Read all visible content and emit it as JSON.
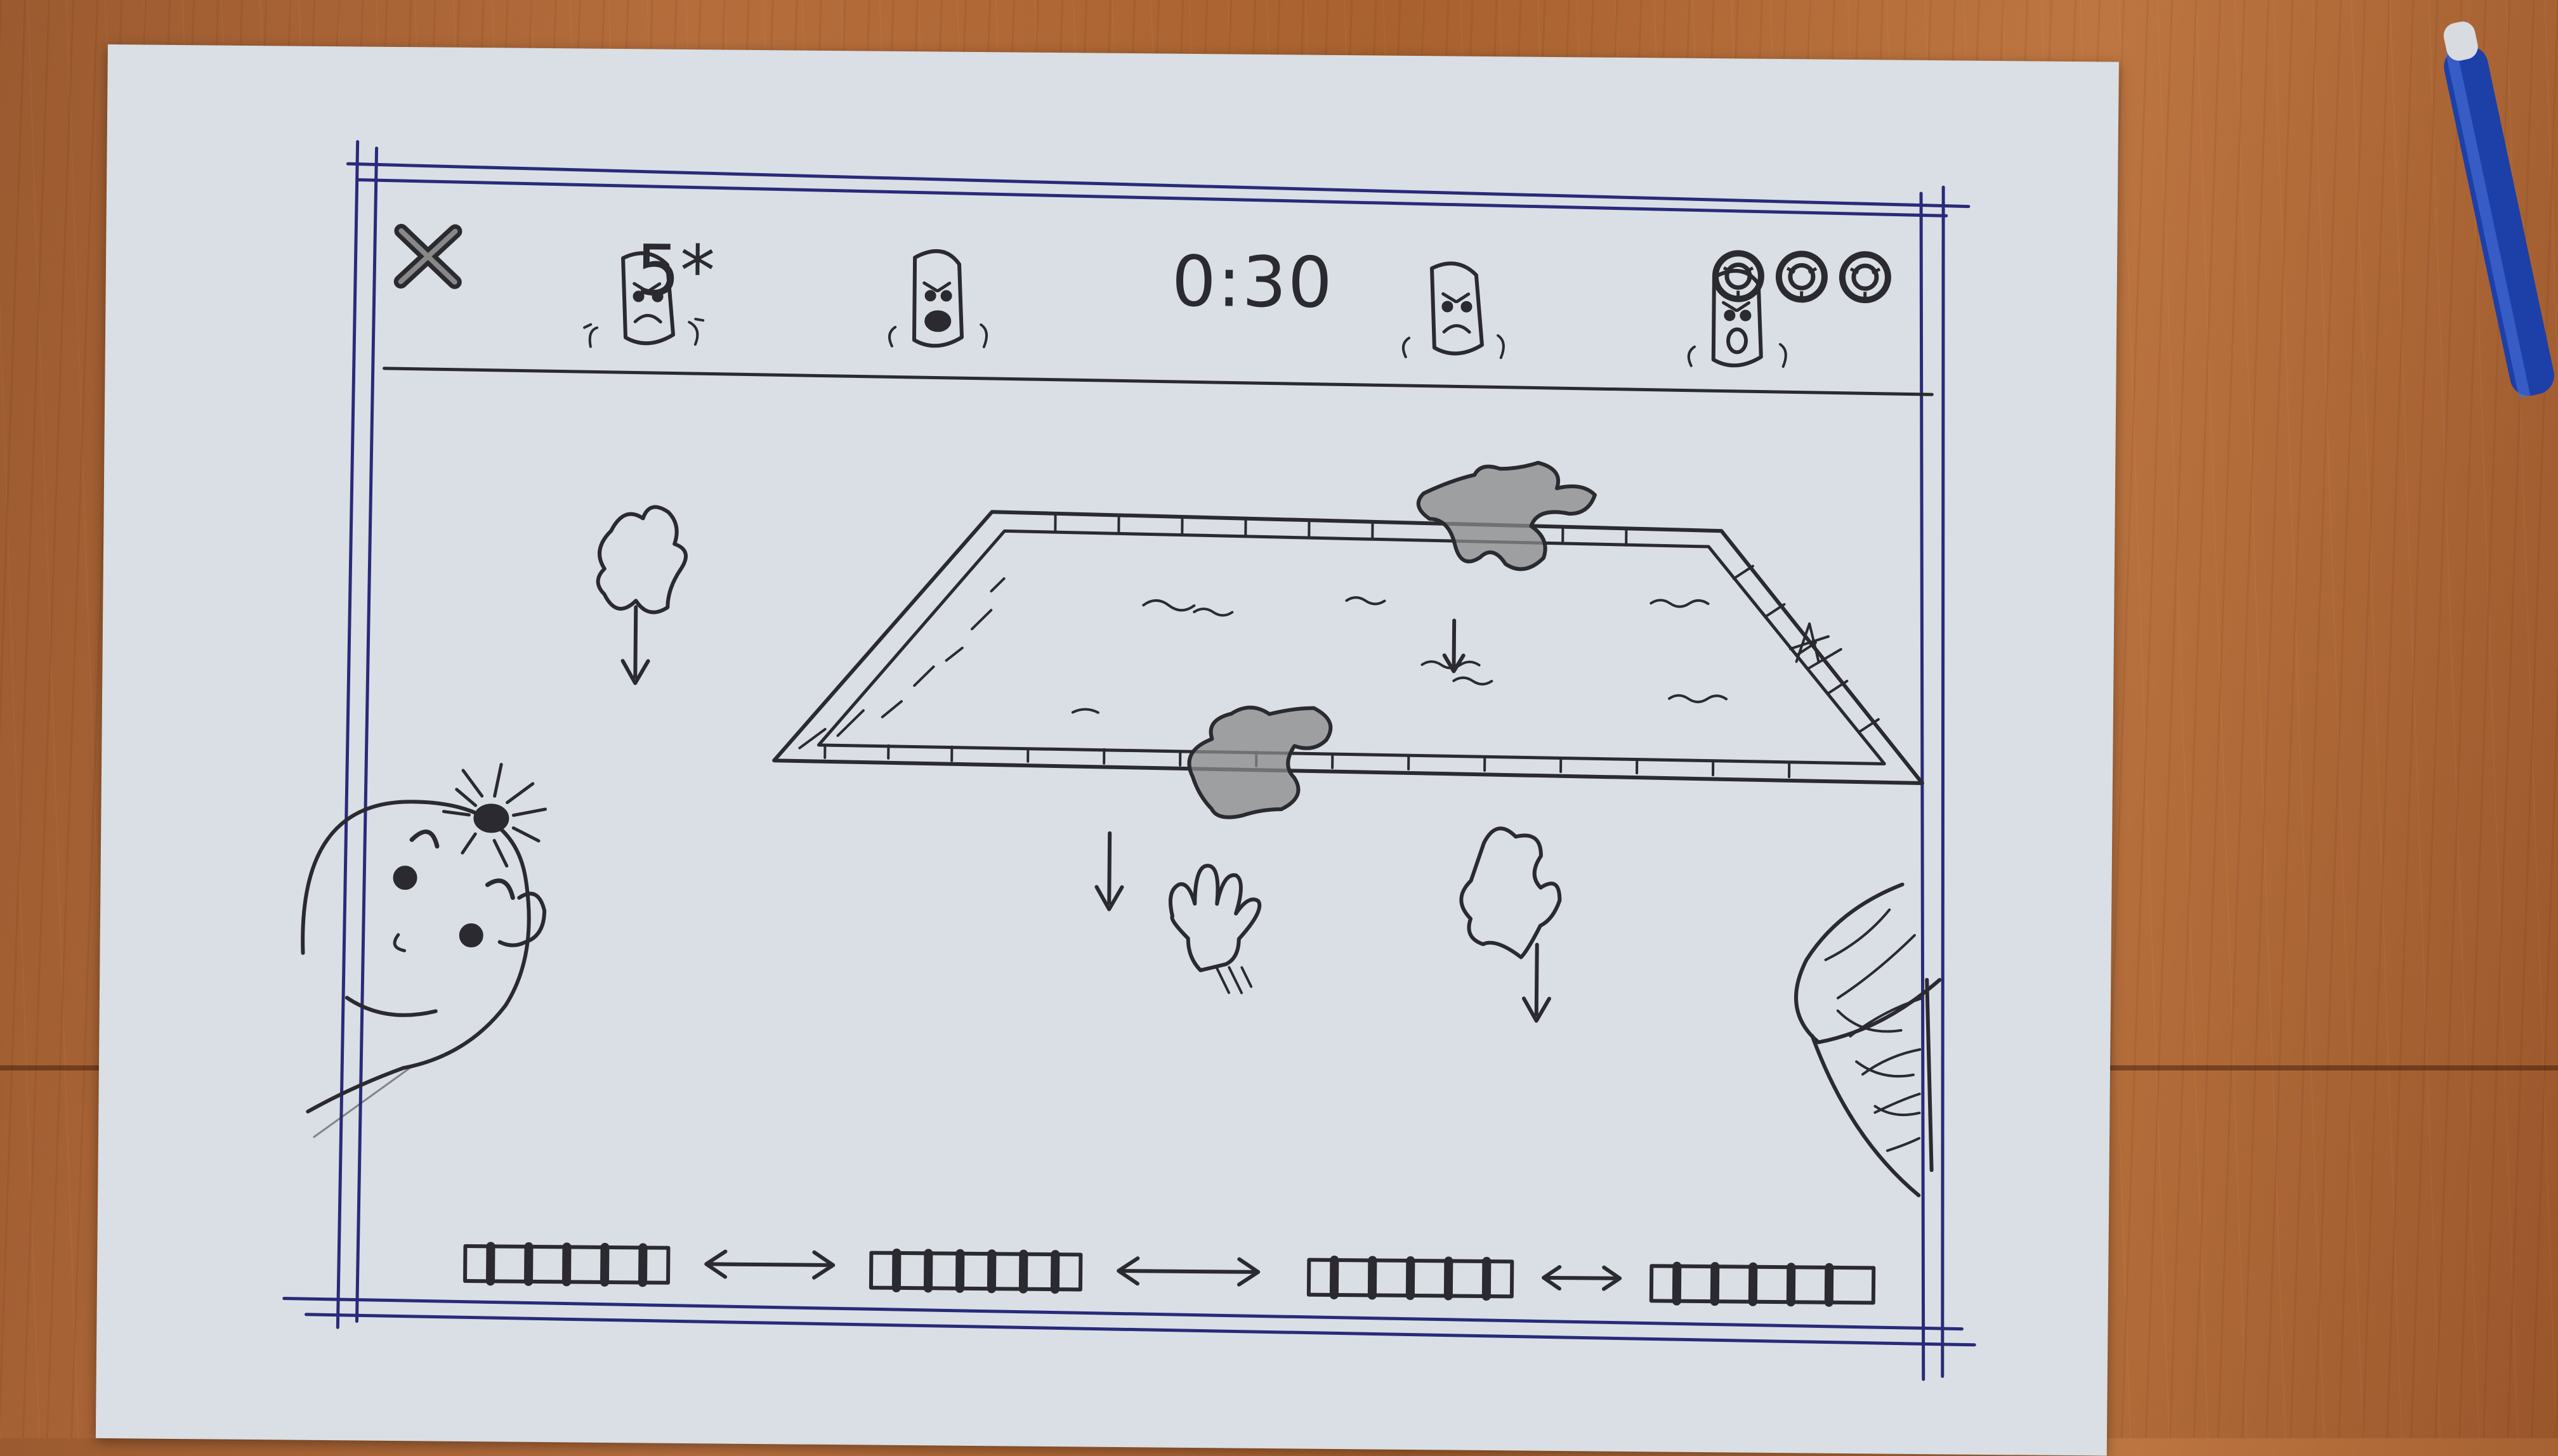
{
  "hud": {
    "close_icon": "x-close-icon",
    "score": "5*",
    "timer": "0:30",
    "lives_icon": "ring-icon",
    "lives": 3
  },
  "creatures": [
    {
      "mood": "angry"
    },
    {
      "mood": "shouting"
    },
    {
      "mood": "angry"
    },
    {
      "mood": "shouting"
    }
  ],
  "colors": {
    "paper": "#d9dfe4",
    "ink": "#2a2a30",
    "frame": "#2a2a7a",
    "stain": "#8a8a8a",
    "desk": "#b06a38"
  }
}
